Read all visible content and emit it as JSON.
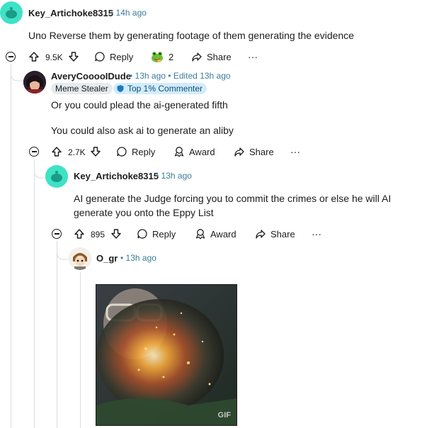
{
  "comments": [
    {
      "username": "Key_Artichoke8315",
      "time": "14h ago",
      "body": "Uno Reverse them by generating footage of them generating the evidence",
      "votes": "9.5K",
      "reply_label": "Reply",
      "award_count": "2",
      "share_label": "Share",
      "more": "···"
    },
    {
      "username": "AveryCooooIDude",
      "time": "13h ago",
      "edited": "Edited 13h ago",
      "flair1": "Meme Stealer",
      "flair2": "Top 1% Commenter",
      "body_line1": "Or you could plead the ai-generated fifth",
      "body_line2": "You could also ask ai to generate an aliby",
      "votes": "2.7K",
      "reply_label": "Reply",
      "award_label": "Award",
      "share_label": "Share",
      "more": "···"
    },
    {
      "username": "Key_Artichoke8315",
      "time": "13h ago",
      "body": "AI generate the Judge forcing you to commit the crimes or else he will AI generate you onto the Eppy List",
      "votes": "895",
      "reply_label": "Reply",
      "award_label": "Award",
      "share_label": "Share",
      "more": "···"
    },
    {
      "username": "O_gr",
      "time": "13h ago",
      "gif_badge": "GIF"
    }
  ],
  "dot": "•",
  "colors": {
    "avatar_teal": "#3ee2c6",
    "meta_blue": "#3d7c99",
    "flair_grey_bg": "#e5ebee",
    "flair_blue_bg": "#d3ecfb",
    "action_grey": "#576f76"
  }
}
